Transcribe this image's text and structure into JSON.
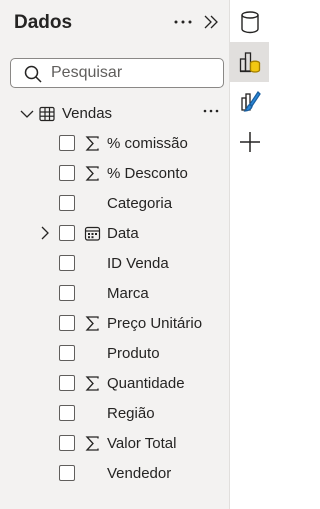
{
  "pane": {
    "title": "Dados",
    "search": {
      "placeholder": "Pesquisar",
      "value": ""
    }
  },
  "table": {
    "name": "Vendas",
    "expanded": true,
    "fields": [
      {
        "label": "% comissão",
        "icon": "sigma-icon",
        "expandable": false,
        "checked": false
      },
      {
        "label": "% Desconto",
        "icon": "sigma-icon",
        "expandable": false,
        "checked": false
      },
      {
        "label": "Categoria",
        "icon": "",
        "expandable": false,
        "checked": false
      },
      {
        "label": "Data",
        "icon": "calendar-icon",
        "expandable": true,
        "checked": false
      },
      {
        "label": "ID Venda",
        "icon": "",
        "expandable": false,
        "checked": false
      },
      {
        "label": "Marca",
        "icon": "",
        "expandable": false,
        "checked": false
      },
      {
        "label": "Preço Unitário",
        "icon": "sigma-icon",
        "expandable": false,
        "checked": false
      },
      {
        "label": "Produto",
        "icon": "",
        "expandable": false,
        "checked": false
      },
      {
        "label": "Quantidade",
        "icon": "sigma-icon",
        "expandable": false,
        "checked": false
      },
      {
        "label": "Região",
        "icon": "",
        "expandable": false,
        "checked": false
      },
      {
        "label": "Valor Total",
        "icon": "sigma-icon",
        "expandable": false,
        "checked": false
      },
      {
        "label": "Vendedor",
        "icon": "",
        "expandable": false,
        "checked": false
      }
    ]
  },
  "rail": {
    "buttons": [
      {
        "icon": "database-icon",
        "active": false
      },
      {
        "icon": "build-visual-icon",
        "active": true
      },
      {
        "icon": "format-brush-icon",
        "active": false
      },
      {
        "icon": "add-icon",
        "active": false
      }
    ]
  },
  "colors": {
    "pane_background": "#f3f2f1",
    "text": "#252423",
    "accent_yellow": "#f2c811",
    "accent_blue": "#2b88d8"
  }
}
